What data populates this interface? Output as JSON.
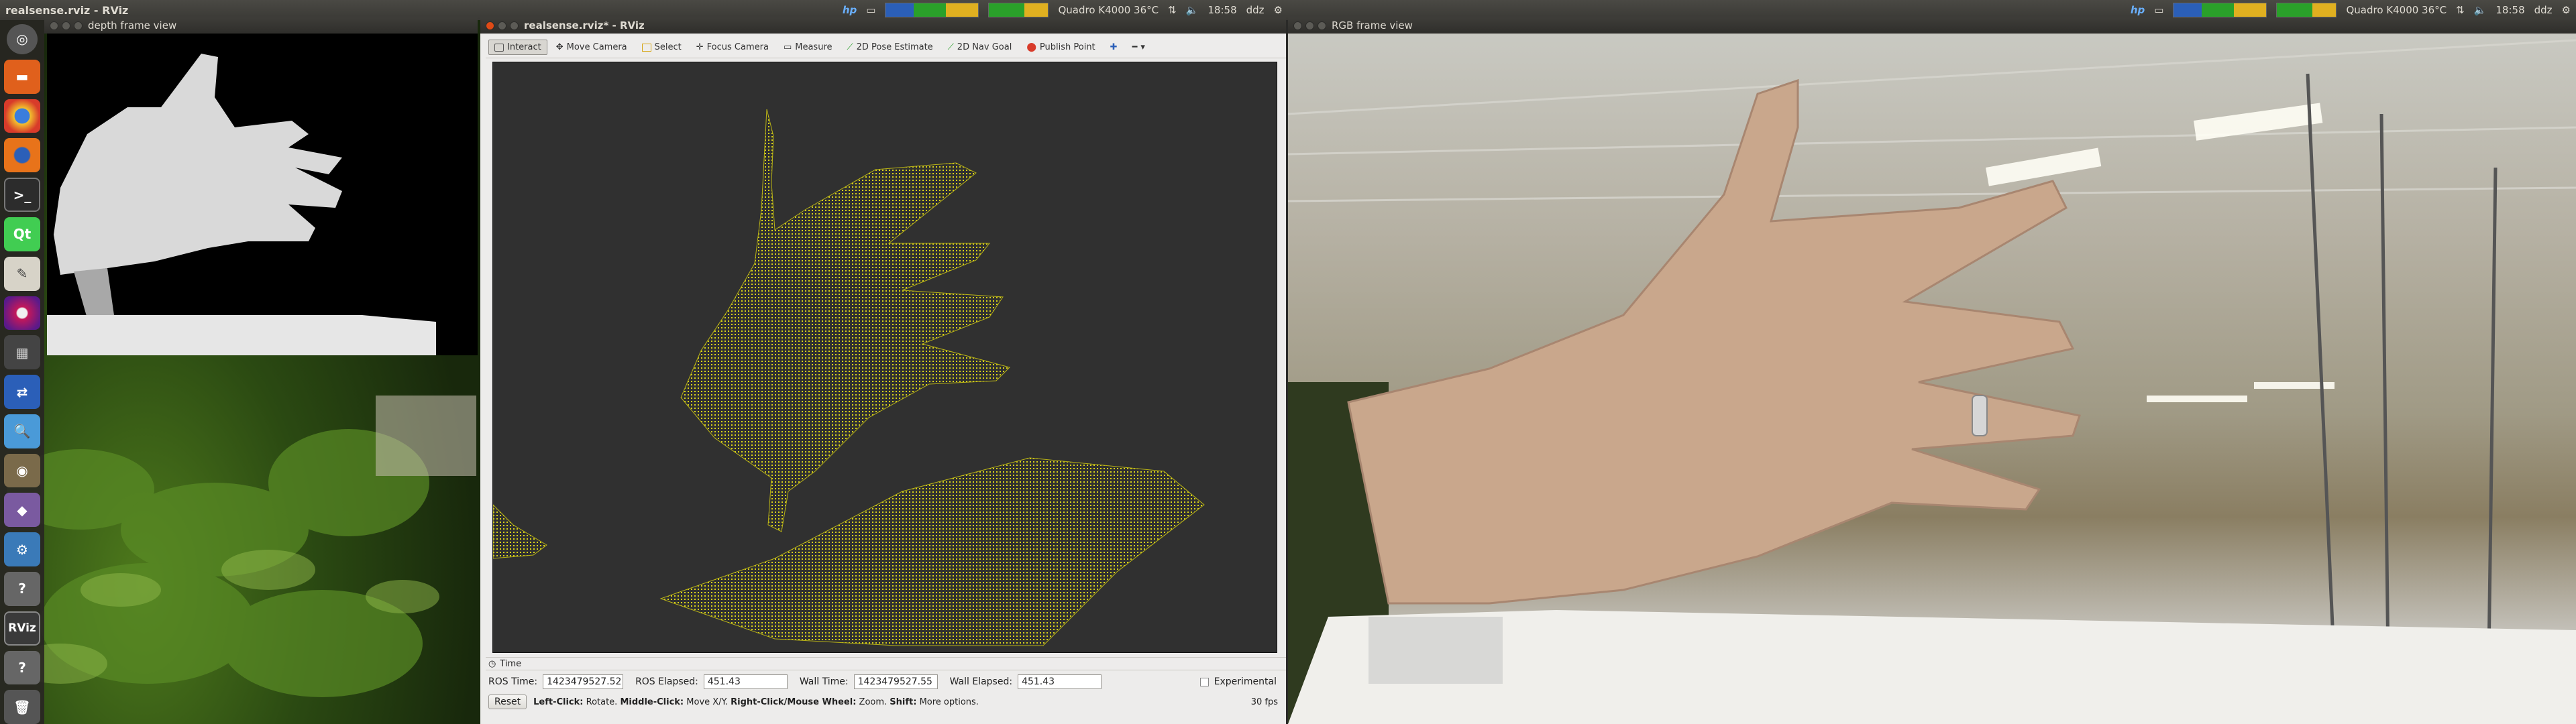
{
  "panels": [
    {
      "title": "realsense.rviz - RViz",
      "gpu": "Quadro K4000 36°C",
      "time": "18:58",
      "user": "ddz"
    },
    {
      "title": "",
      "gpu": "Quadro K4000 36°C",
      "time": "18:58",
      "user": "ddz"
    }
  ],
  "windows": {
    "depth": {
      "title": "depth frame view"
    },
    "rviz": {
      "title": "realsense.rviz* - RViz"
    },
    "rgb": {
      "title": "RGB frame view"
    }
  },
  "toolbar": {
    "interact": "Interact",
    "move_camera": "Move Camera",
    "select": "Select",
    "focus_camera": "Focus Camera",
    "measure": "Measure",
    "pose_estimate": "2D Pose Estimate",
    "nav_goal": "2D Nav Goal",
    "publish_point": "Publish Point"
  },
  "time_panel": {
    "header": "Time",
    "ros_time_label": "ROS Time:",
    "ros_time": "1423479527.52",
    "ros_elapsed_label": "ROS Elapsed:",
    "ros_elapsed": "451.43",
    "wall_time_label": "Wall Time:",
    "wall_time": "1423479527.55",
    "wall_elapsed_label": "Wall Elapsed:",
    "wall_elapsed": "451.43",
    "experimental": "Experimental",
    "reset": "Reset",
    "hint_left_b": "Left-Click:",
    "hint_left": " Rotate. ",
    "hint_mid_b": "Middle-Click:",
    "hint_mid": " Move X/Y. ",
    "hint_right_b": "Right-Click/Mouse Wheel:",
    "hint_right": " Zoom. ",
    "hint_shift_b": "Shift:",
    "hint_shift": " More options.",
    "fps": "30 fps"
  },
  "launcher": [
    "dash-icon",
    "files-icon",
    "chrome-icon",
    "firefox-icon",
    "terminal-icon",
    "qt-creator-icon",
    "text-editor-icon",
    "disk-icon",
    "calculator-icon",
    "network-icon",
    "search-app-icon",
    "gimp-icon",
    "app-icon",
    "settings-icon",
    "help-icon",
    "rviz-icon",
    "help-icon-2",
    "trash-icon"
  ],
  "launcher_labels": {
    "rviz": "RViz"
  },
  "colors": {
    "cloud": "#d8d21a",
    "accent": "#df4a16",
    "cpu": "#2aa02a",
    "mem": "#e0b020"
  }
}
